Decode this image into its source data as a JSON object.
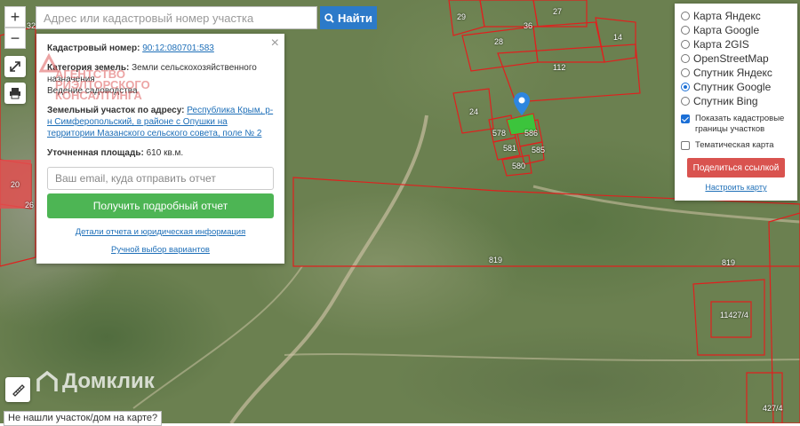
{
  "search": {
    "placeholder": "Адрес или кадастровый номер участка",
    "button_label": "Найти"
  },
  "map_controls": {
    "zoom_in": "+",
    "zoom_out": "−"
  },
  "info_panel": {
    "cadastral_label": "Кадастровый номер:",
    "cadastral_value": "90:12:080701:583",
    "category_label": "Категория земель:",
    "category_value": "Земли сельскохозяйственного назначения",
    "use_value": "Ведение садоводства",
    "address_label": "Земельный участок по адресу:",
    "address_value": "Республика Крым, р-н Симферопольский, в районе с Опушки на территории Мазанского сельского совета, поле № 2",
    "area_label": "Уточненная площадь:",
    "area_value": "610 кв.м.",
    "email_placeholder": "Ваш email, куда отправить отчет",
    "report_button": "Получить подробный отчет",
    "details_link": "Детали отчета и юридическая информация",
    "manual_link": "Ручной выбор вариантов",
    "watermark": "АГЕНТСТВО РИЭЛТОРСКОГО КОНСАЛТИНГА"
  },
  "layers": {
    "options": [
      {
        "label": "Карта Яндекс",
        "selected": false
      },
      {
        "label": "Карта Google",
        "selected": false
      },
      {
        "label": "Карта 2GIS",
        "selected": false
      },
      {
        "label": "OpenStreetMap",
        "selected": false
      },
      {
        "label": "Спутник Яндекс",
        "selected": false
      },
      {
        "label": "Спутник Google",
        "selected": true
      },
      {
        "label": "Спутник Bing",
        "selected": false
      }
    ],
    "show_cadastral": "Показать кадастровые границы участков",
    "thematic_map": "Тематическая карта",
    "share_button": "Поделиться ссылкой",
    "configure_link": "Настроить карту"
  },
  "parcel_labels": {
    "p29": "29",
    "p36": "36",
    "p27": "27",
    "p28": "28",
    "p14": "14",
    "p112": "112",
    "p24": "24",
    "p578": "578",
    "p586": "586",
    "p581": "581",
    "p585": "585",
    "p580": "580",
    "p819a": "819",
    "p819b": "819",
    "p11427": "11427/4",
    "p32": "32",
    "p20": "20",
    "p26": "26",
    "p427": "427/4"
  },
  "logo_text": "Домклик",
  "not_found_text": "Не нашли участок/дом на карте?",
  "colors": {
    "accent_blue": "#2c7ac9",
    "green_button": "#4db554",
    "red_button": "#d9534f",
    "parcel_border": "#e0201e"
  }
}
